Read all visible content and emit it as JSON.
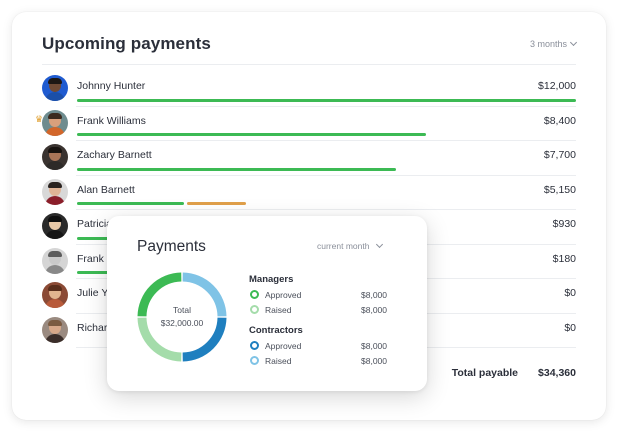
{
  "card": {
    "title": "Upcoming payments",
    "period": "3 months",
    "rows": [
      {
        "name": "Johnny Hunter",
        "amount": "$12,000",
        "progress": 1.0,
        "skin": "#6f4a35",
        "hair": "#1d1714",
        "shirt": "#1b4fa8",
        "bg": "#1f5bd0"
      },
      {
        "name": "Frank Williams",
        "amount": "$8,400",
        "progress": 0.7,
        "skin": "#d9a07c",
        "hair": "#3b2a1e",
        "shirt": "#d2662a",
        "bg": "#6e8c8f",
        "crown": true
      },
      {
        "name": "Zachary Barnett",
        "amount": "$7,700",
        "progress": 0.64,
        "skin": "#a97558",
        "hair": "#181310",
        "shirt": "#2d2a28",
        "bg": "#3a3330"
      },
      {
        "name": "Alan Barnett",
        "amount": "$5,150",
        "progress": 0.44,
        "secondary": {
          "start": 0.215,
          "end": 0.333
        },
        "skin": "#e0b496",
        "hair": "#2a2320",
        "shirt": "#8b1e2a",
        "bg": "#d8d8d8"
      },
      {
        "name": "Patricia",
        "amount": "$930",
        "progress": 0.09,
        "skin": "#e8c9a8",
        "hair": "#0f0f0f",
        "shirt": "#151515",
        "bg": "#2a2a2a"
      },
      {
        "name": "Frank",
        "amount": "$180",
        "progress": 0.09,
        "skin": "#c9c9c9",
        "hair": "#5c5c5c",
        "shirt": "#888888",
        "bg": "#d5d5d5"
      },
      {
        "name": "Julie Y",
        "amount": "$0",
        "progress": 0,
        "skin": "#e2b48f",
        "hair": "#5a2e1c",
        "shirt": "#b85a3a",
        "bg": "#8b4a35"
      },
      {
        "name": "Richar",
        "amount": "$0",
        "progress": 0,
        "skin": "#d7a889",
        "hair": "#7a5a40",
        "shirt": "#3b2e2a",
        "bg": "#9a8a80"
      }
    ],
    "total_label": "Total payable",
    "total_value": "$34,360"
  },
  "popup": {
    "title": "Payments",
    "period": "current month",
    "donut": {
      "label": "Total",
      "value": "$32,000.00",
      "segments": [
        {
          "share": 0.25,
          "color": "#7fc3e6"
        },
        {
          "share": 0.25,
          "color": "#1f7fbf"
        },
        {
          "share": 0.25,
          "color": "#a4dcaa"
        },
        {
          "share": 0.25,
          "color": "#3cba54"
        }
      ]
    },
    "managers": {
      "title": "Managers",
      "items": [
        {
          "label": "Approved",
          "value": "$8,000",
          "color": "#3cba54"
        },
        {
          "label": "Raised",
          "value": "$8,000",
          "color": "#a4dcaa"
        }
      ]
    },
    "contractors": {
      "title": "Contractors",
      "items": [
        {
          "label": "Approved",
          "value": "$8,000",
          "color": "#1f7fbf"
        },
        {
          "label": "Raised",
          "value": "$8,000",
          "color": "#7fc3e6"
        }
      ]
    }
  }
}
